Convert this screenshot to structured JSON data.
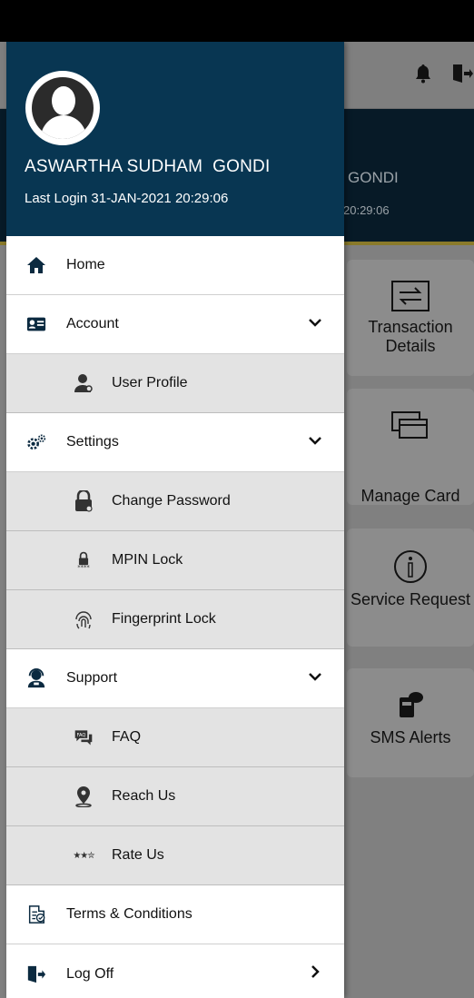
{
  "background_app": {
    "header_name_partial": "GONDI",
    "header_time_partial": "20:29:06",
    "tiles": [
      {
        "label": "Transaction Details",
        "icon": "transaction-icon"
      },
      {
        "label": "Manage Card",
        "icon": "card-icon"
      },
      {
        "label": "Service Request",
        "icon": "info-icon"
      },
      {
        "label": "SMS Alerts",
        "icon": "sms-icon"
      }
    ]
  },
  "drawer": {
    "user_name": "ASWARTHA SUDHAM  GONDI",
    "last_login": "Last Login 31-JAN-2021 20:29:06",
    "items": [
      {
        "label": "Home",
        "icon": "home-icon",
        "level": "main"
      },
      {
        "label": "Account",
        "icon": "account-card-icon",
        "level": "main",
        "expanded": true
      },
      {
        "label": "User Profile",
        "icon": "user-profile-icon",
        "level": "sub"
      },
      {
        "label": "Settings",
        "icon": "gears-icon",
        "level": "main",
        "expanded": true
      },
      {
        "label": "Change Password",
        "icon": "lock-key-icon",
        "level": "sub"
      },
      {
        "label": "MPIN Lock",
        "icon": "pin-lock-icon",
        "level": "sub"
      },
      {
        "label": "Fingerprint Lock",
        "icon": "fingerprint-icon",
        "level": "sub"
      },
      {
        "label": "Support",
        "icon": "support-agent-icon",
        "level": "main",
        "expanded": true
      },
      {
        "label": "FAQ",
        "icon": "faq-icon",
        "level": "sub"
      },
      {
        "label": "Reach Us",
        "icon": "location-pin-icon",
        "level": "sub"
      },
      {
        "label": "Rate Us",
        "icon": "stars-icon",
        "level": "sub"
      },
      {
        "label": "Terms & Conditions",
        "icon": "terms-icon",
        "level": "main"
      },
      {
        "label": "Log Off",
        "icon": "logout-icon",
        "level": "main"
      }
    ]
  },
  "colors": {
    "drawer_header": "#083652",
    "submenu_bg": "#e3e3e3",
    "icon_color": "#0b2a40"
  }
}
